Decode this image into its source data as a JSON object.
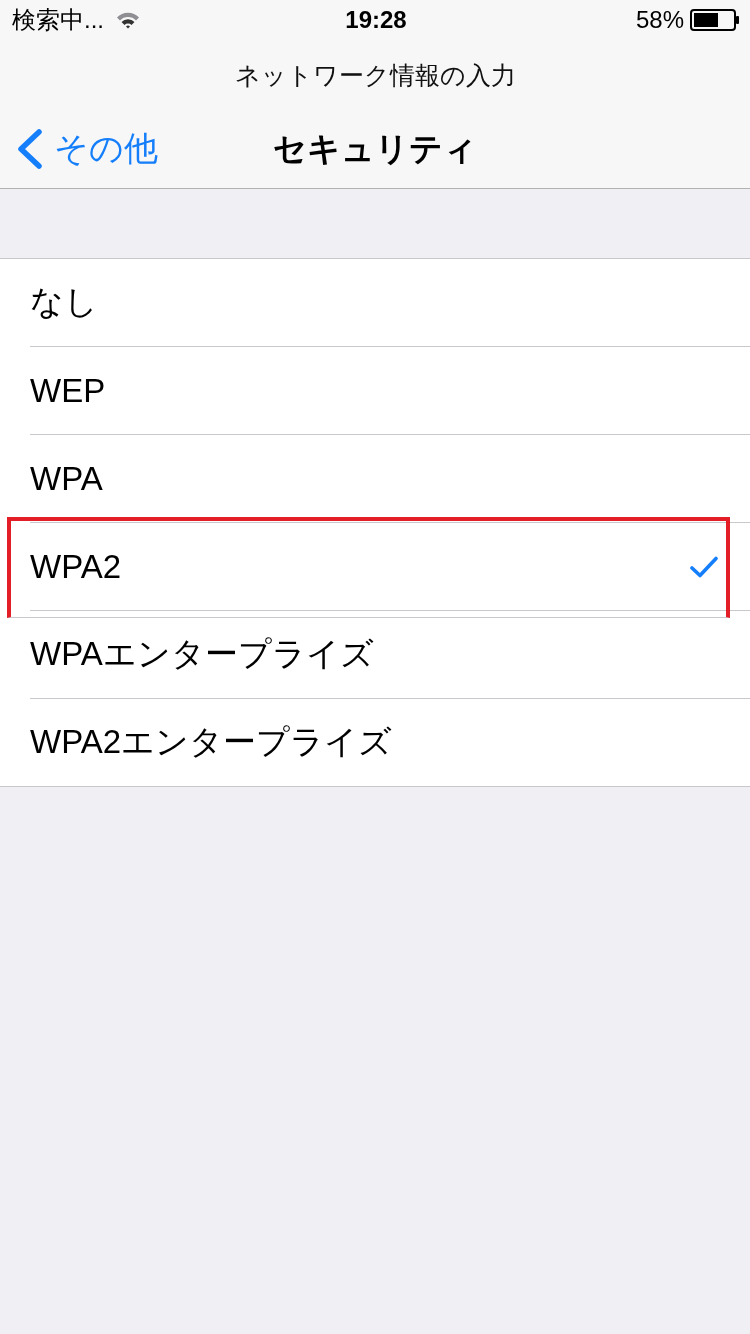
{
  "status_bar": {
    "carrier": "検索中...",
    "time": "19:28",
    "battery": "58%"
  },
  "nav": {
    "prompt": "ネットワーク情報の入力",
    "back": "その他",
    "title": "セキュリティ"
  },
  "options": [
    {
      "label": "なし",
      "selected": false,
      "highlighted": false
    },
    {
      "label": "WEP",
      "selected": false,
      "highlighted": false
    },
    {
      "label": "WPA",
      "selected": false,
      "highlighted": false
    },
    {
      "label": "WPA2",
      "selected": true,
      "highlighted": true
    },
    {
      "label": "WPAエンタープライズ",
      "selected": false,
      "highlighted": false
    },
    {
      "label": "WPA2エンタープライズ",
      "selected": false,
      "highlighted": false
    }
  ]
}
